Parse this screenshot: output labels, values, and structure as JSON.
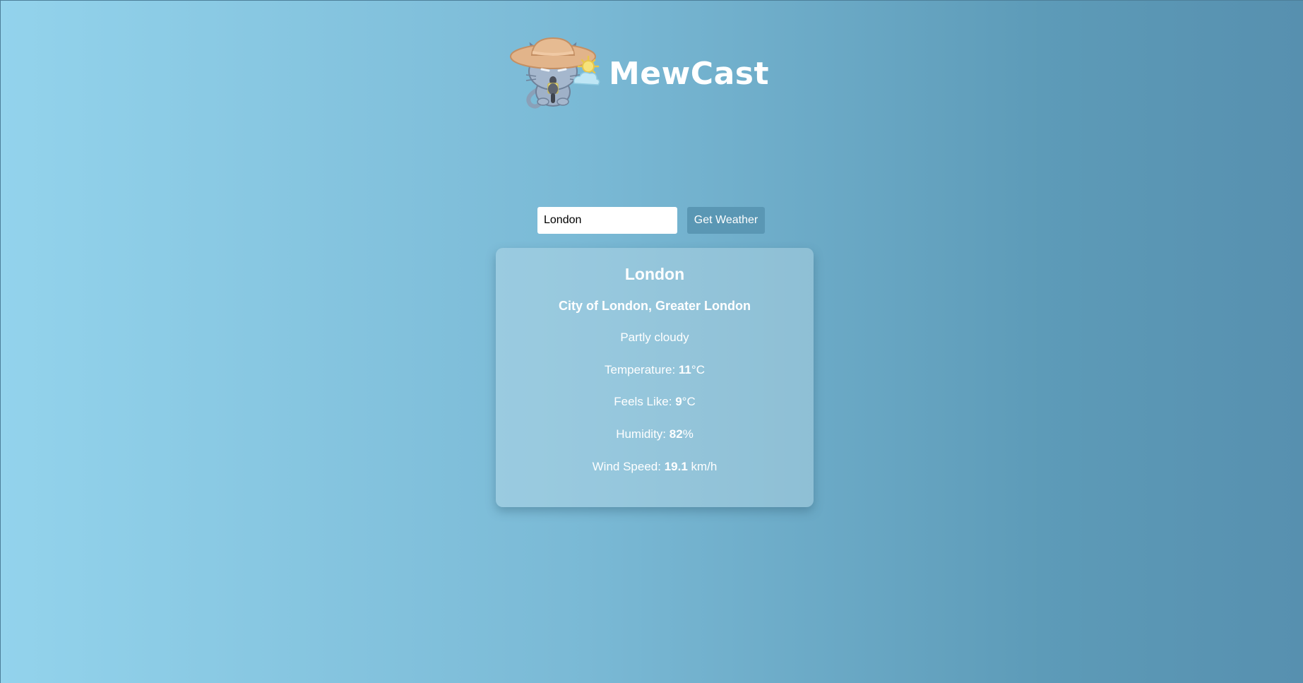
{
  "header": {
    "brand": "MewCast",
    "logo_icon": "cat-with-sunhat-and-weather-icon"
  },
  "search": {
    "value": "London",
    "button_label": "Get Weather"
  },
  "weather": {
    "city": "London",
    "region": "City of London, Greater London",
    "condition": "Partly cloudy",
    "temperature_label": "Temperature: ",
    "temperature_value": "11",
    "temperature_unit": "°C",
    "feels_label": "Feels Like: ",
    "feels_value": "9",
    "feels_unit": "°C",
    "humidity_label": "Humidity: ",
    "humidity_value": "82",
    "humidity_unit": "%",
    "wind_label": "Wind Speed: ",
    "wind_value": "19.1",
    "wind_unit": " km/h"
  },
  "colors": {
    "background_start": "#93d3ec",
    "background_end": "#5790af",
    "button": "#5a97b4",
    "text": "#ffffff"
  }
}
